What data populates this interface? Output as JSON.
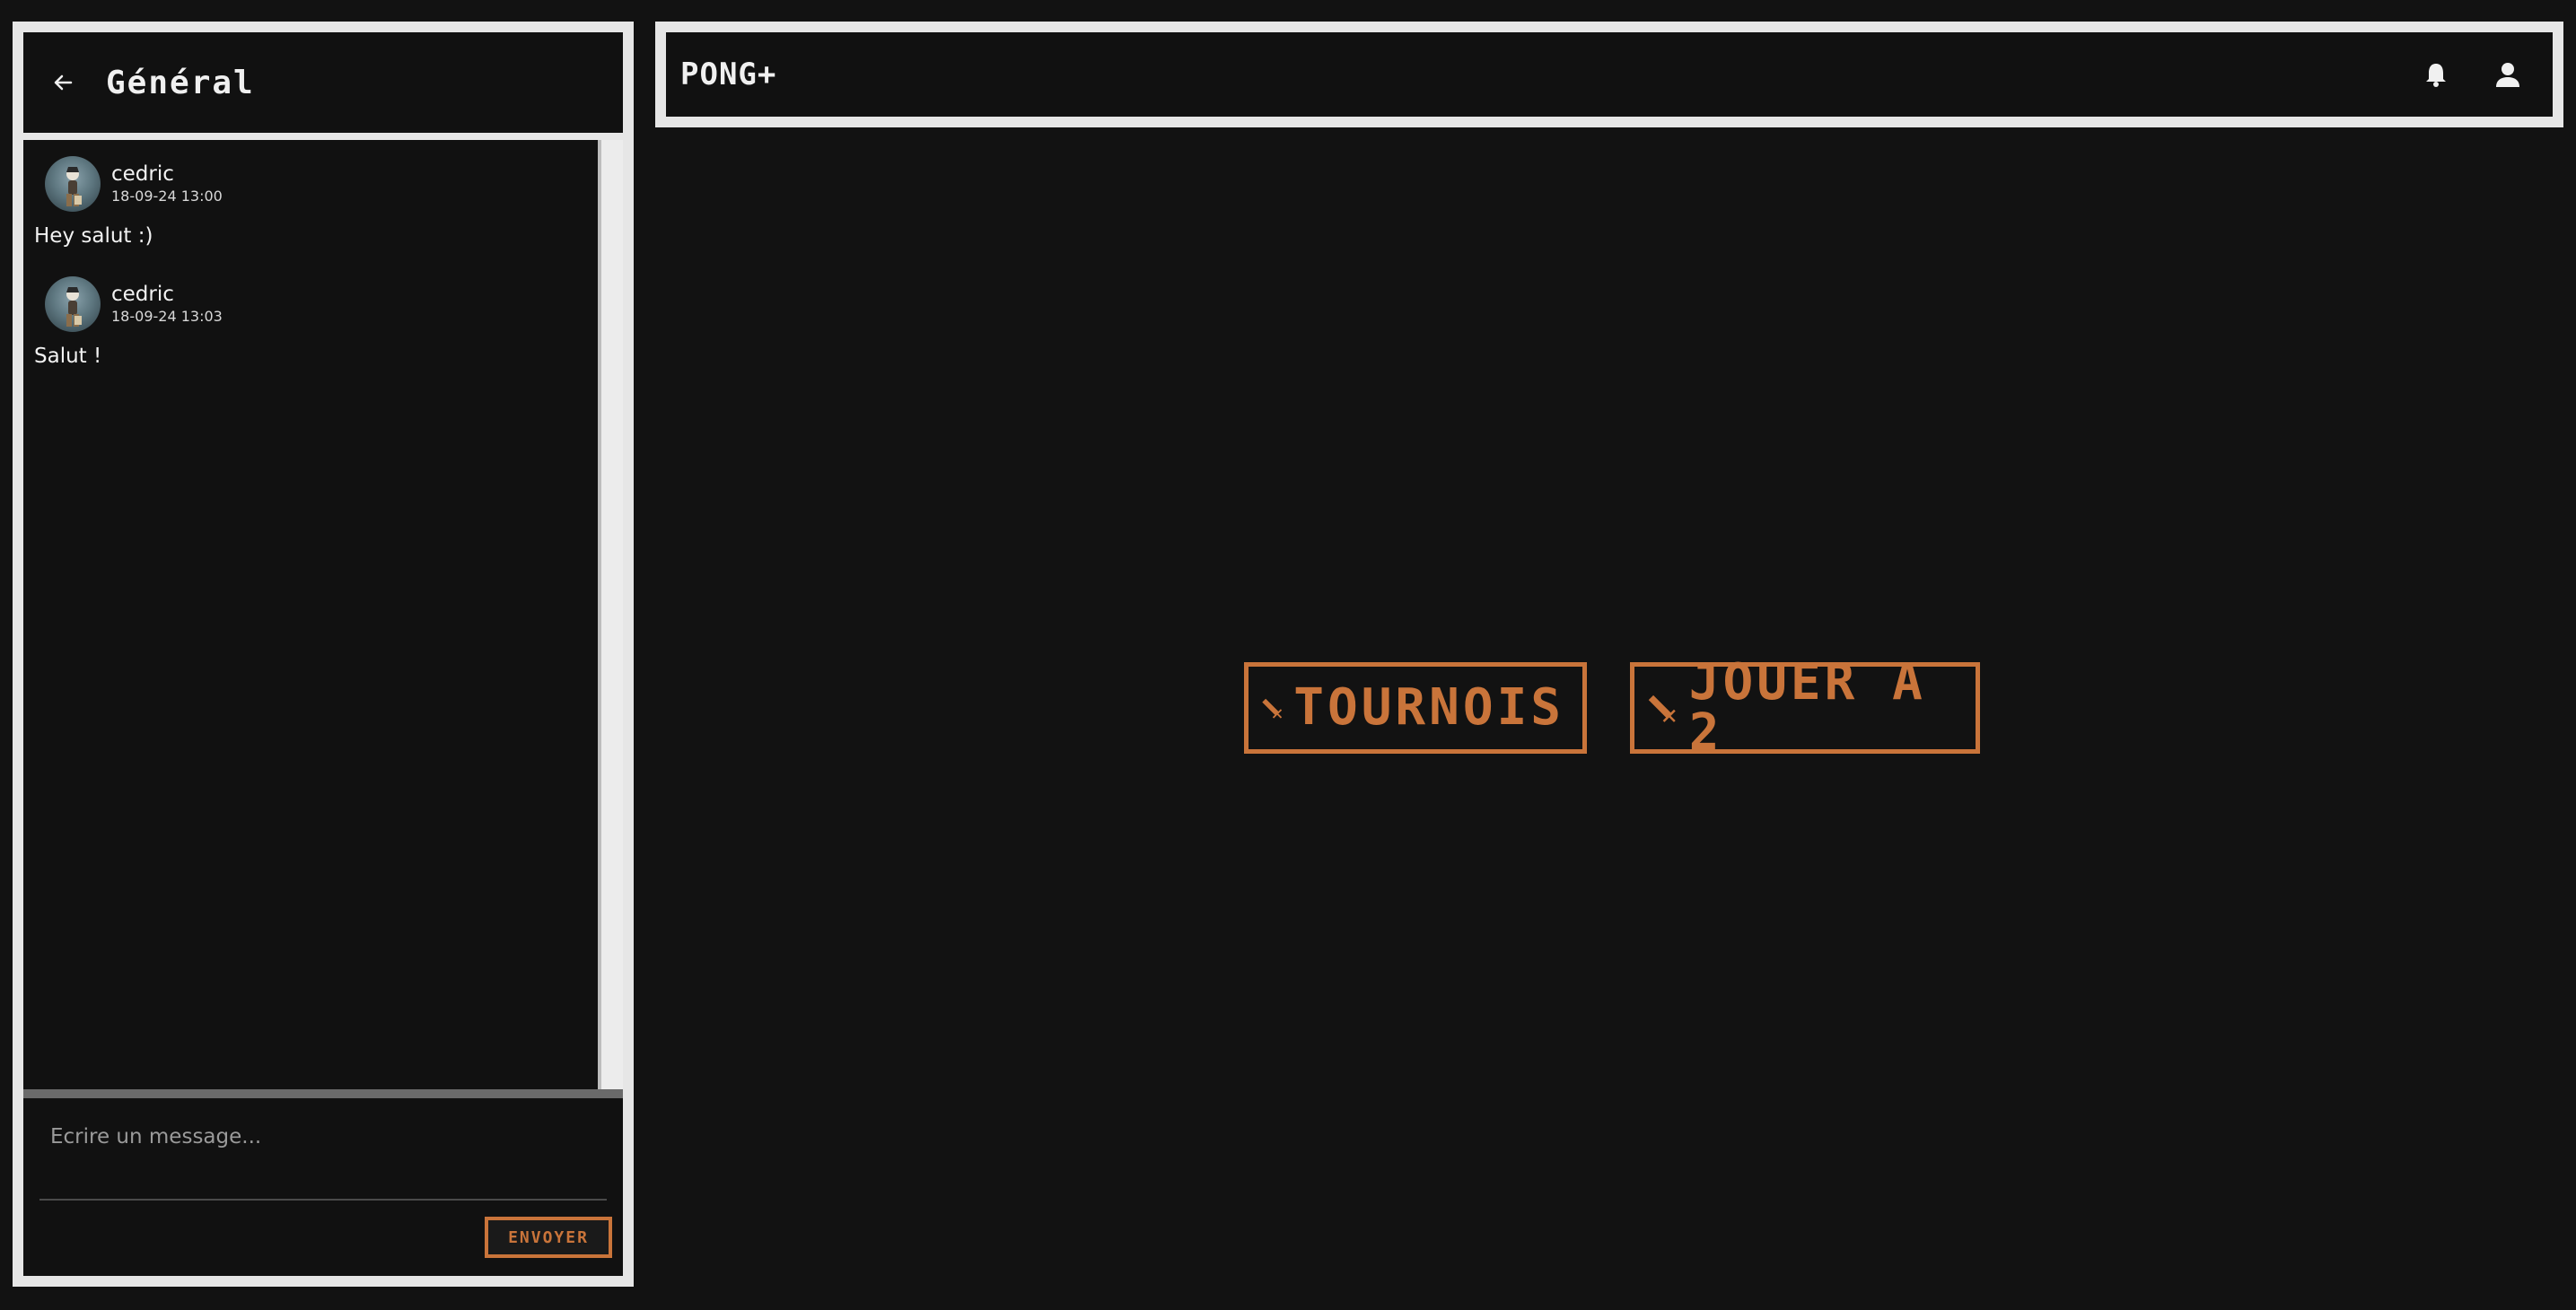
{
  "chat": {
    "title": "Général",
    "messages": [
      {
        "author": "cedric",
        "time": "18-09-24 13:00",
        "text": "Hey salut :)"
      },
      {
        "author": "cedric",
        "time": "18-09-24 13:03",
        "text": "Salut !"
      }
    ],
    "composer": {
      "placeholder": "Ecrire un message...",
      "send_label": "ENVOYER"
    }
  },
  "topbar": {
    "brand": "PONG+",
    "icons": [
      "bell-icon",
      "user-icon"
    ]
  },
  "actions": {
    "tournament_label": "TOURNOIS",
    "two_player_label": "JOUER A 2"
  },
  "colors": {
    "accent": "#c9743a",
    "background": "#121212",
    "frame": "#e6e6e6"
  }
}
